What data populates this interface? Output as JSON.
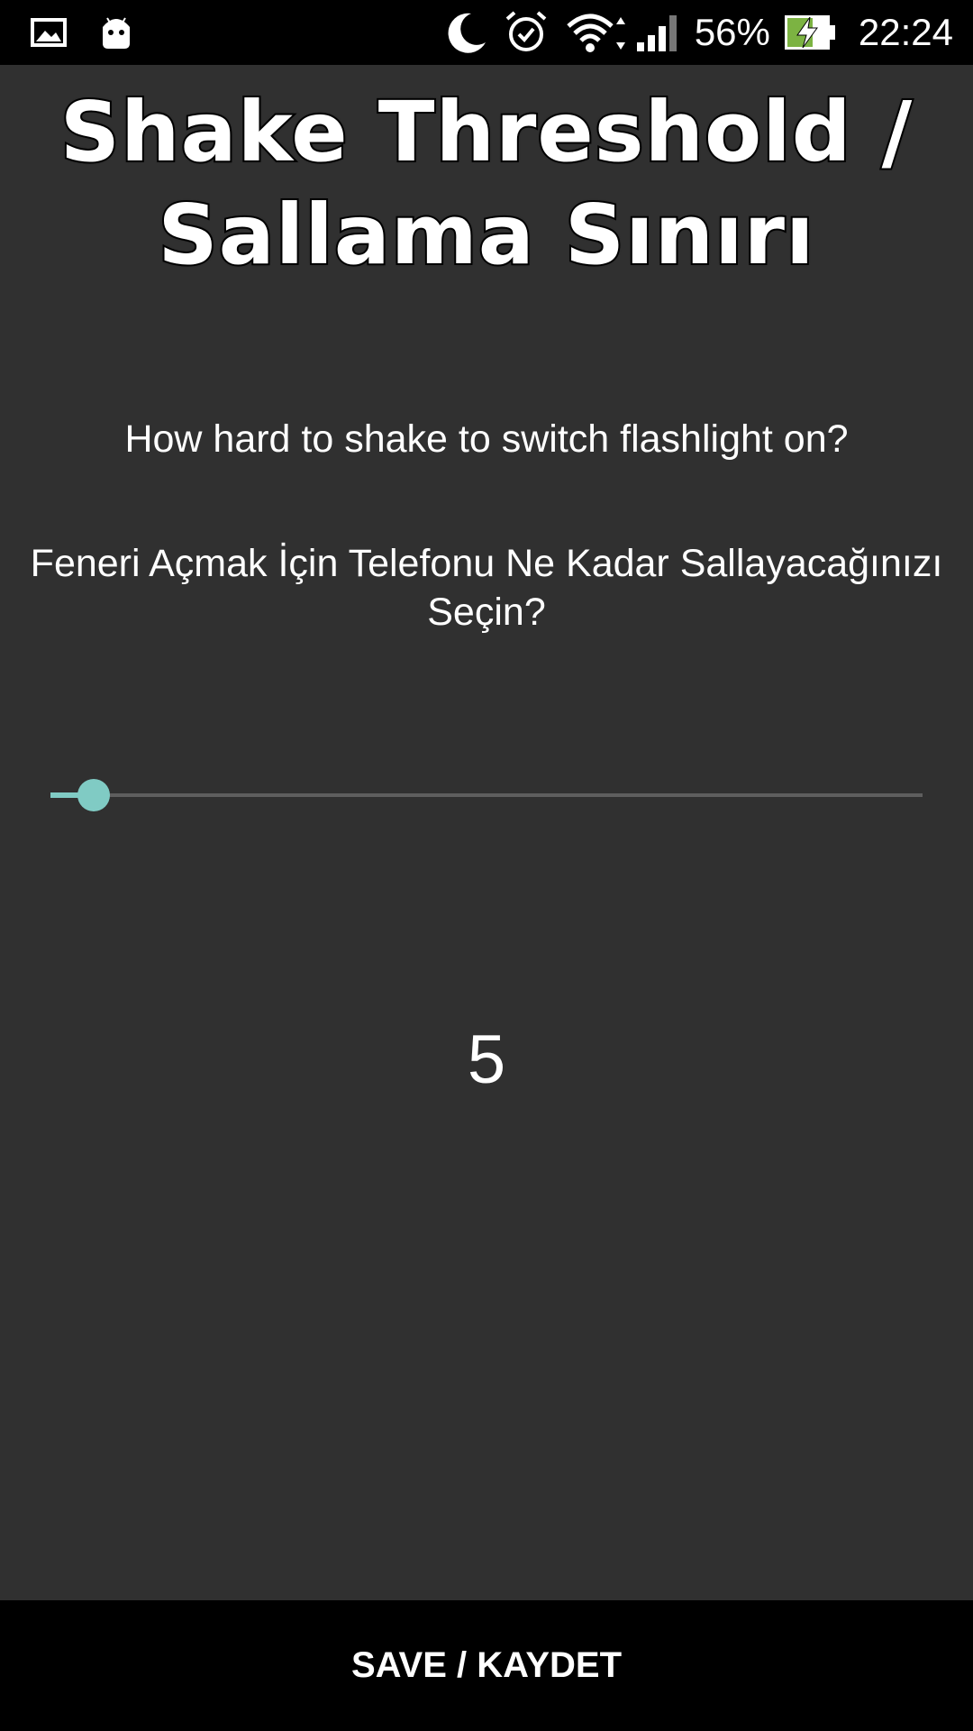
{
  "status_bar": {
    "icons_left": [
      "gallery-icon",
      "android-icon"
    ],
    "icons_right": [
      "moon-icon",
      "alarm-icon",
      "wifi-icon",
      "signal-icon",
      "battery-charging-icon"
    ],
    "battery_percent": "56%",
    "time": "22:24"
  },
  "page": {
    "title_line1": "Shake Threshold /",
    "title_line2": "Sallama Sınırı",
    "question_en": "How hard to shake to switch flashlight on?",
    "question_tr": "Feneri Açmak İçin Telefonu Ne Kadar Sallayacağınızı Seçin?",
    "slider": {
      "value": 5,
      "min": 0,
      "max": 100,
      "accent_color": "#80cbc4"
    },
    "value_display": "5"
  },
  "footer": {
    "save_label": "SAVE / KAYDET"
  },
  "colors": {
    "background": "#303030",
    "bars": "#000000",
    "accent": "#80cbc4"
  }
}
